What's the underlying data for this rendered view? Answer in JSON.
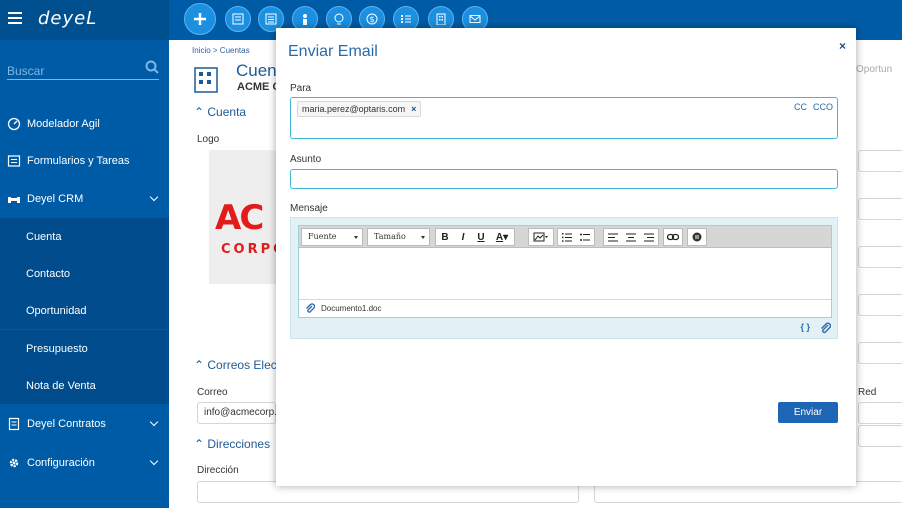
{
  "app": {
    "logo_text": "deyeL"
  },
  "sidebar": {
    "search_placeholder": "Buscar",
    "items": [
      {
        "label": "Modelador Agil"
      },
      {
        "label": "Formularios y Tareas"
      },
      {
        "label": "Deyel CRM"
      },
      {
        "label": "Cuenta"
      },
      {
        "label": "Contacto"
      },
      {
        "label": "Oportunidad"
      },
      {
        "label": "Presupuesto"
      },
      {
        "label": "Nota de Venta"
      },
      {
        "label": "Deyel Contratos"
      },
      {
        "label": "Configuración"
      }
    ]
  },
  "background": {
    "breadcrumb": "Inicio > Cuentas",
    "page_title": "Cuen",
    "account_name": "ACME C",
    "section_cuenta": "Cuenta",
    "logo_label": "Logo",
    "section_correos": "Correos Electr",
    "correo_label": "Correo",
    "correo_value": "info@acmecorp.",
    "section_direcciones": "Direcciones",
    "direccion_label": "Dirección",
    "right_red_label": "Red",
    "right_oportun": "Oportun",
    "logo_text_top": "AC",
    "logo_text_bottom": "CORPO"
  },
  "modal": {
    "title": "Enviar Email",
    "close_glyph": "×",
    "para_label": "Para",
    "recipient": "maria.perez@optaris.com",
    "recipient_remove": "×",
    "cc": "CC",
    "cco": "CCO",
    "asunto_label": "Asunto",
    "asunto_value": "",
    "mensaje_label": "Mensaje",
    "font_select": "Fuente",
    "size_select": "Tamaño",
    "attachment": "Documento1.doc",
    "code_glyph": "{ }",
    "send_button": "Enviar"
  },
  "colors": {
    "sidebar": "#005ba6",
    "accent": "#1d66b5",
    "field_border": "#41b6d8"
  }
}
